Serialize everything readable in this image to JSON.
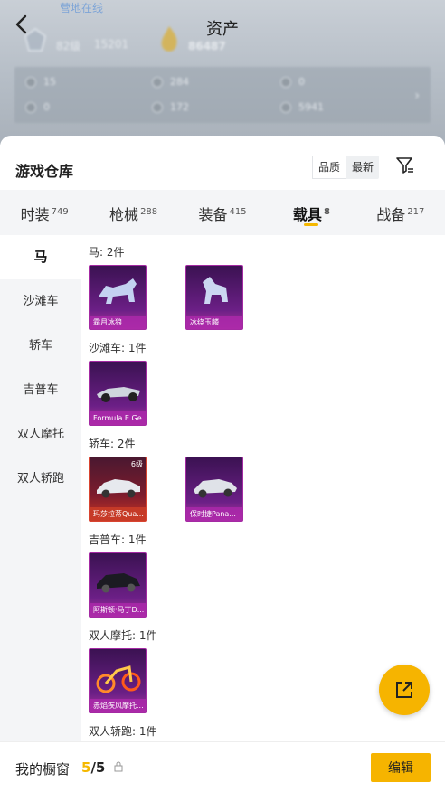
{
  "header": {
    "title": "资产",
    "online_status": "营地在线",
    "level": "82级",
    "coins": "15201",
    "asset_value": "86487",
    "stats": [
      {
        "icon": "ticket-icon",
        "value": "15"
      },
      {
        "icon": "gear-coin-icon",
        "value": "284"
      },
      {
        "icon": "gold-coin-icon",
        "value": "0"
      },
      {
        "icon": "gem-icon",
        "value": "0"
      },
      {
        "icon": "silver-coin-icon",
        "value": "172"
      },
      {
        "icon": "bronze-coin-icon",
        "value": "5941"
      }
    ]
  },
  "warehouse": {
    "title": "游戏仓库",
    "sort_options": [
      "品质",
      "最新"
    ],
    "active_sort": "品质"
  },
  "tabs": [
    {
      "label": "时装",
      "count": "749"
    },
    {
      "label": "枪械",
      "count": "288"
    },
    {
      "label": "装备",
      "count": "415"
    },
    {
      "label": "载具",
      "count": "8",
      "active": true
    },
    {
      "label": "战备",
      "count": "217"
    }
  ],
  "sidebar": [
    "马",
    "沙滩车",
    "轿车",
    "吉普车",
    "双人摩托",
    "双人轿跑"
  ],
  "sections": [
    {
      "label": "马: 2件",
      "items": [
        {
          "name": "霜月冰狼"
        },
        {
          "name": "冰绕玉麟"
        }
      ]
    },
    {
      "label": "沙滩车: 1件",
      "items": [
        {
          "name": "Formula E Ge..."
        }
      ]
    },
    {
      "label": "轿车: 2件",
      "items": [
        {
          "name": "玛莎拉蒂Qua...",
          "level": "6级"
        },
        {
          "name": "保时捷Pana..."
        }
      ]
    },
    {
      "label": "吉普车: 1件",
      "items": [
        {
          "name": "阿斯顿·马丁D..."
        }
      ]
    },
    {
      "label": "双人摩托: 1件",
      "items": [
        {
          "name": "赤焰疾风摩托..."
        }
      ]
    },
    {
      "label": "双人轿跑: 1件",
      "items": []
    }
  ],
  "bottom": {
    "label": "我的橱窗",
    "current": "5",
    "total": "/5",
    "edit_label": "编辑"
  }
}
